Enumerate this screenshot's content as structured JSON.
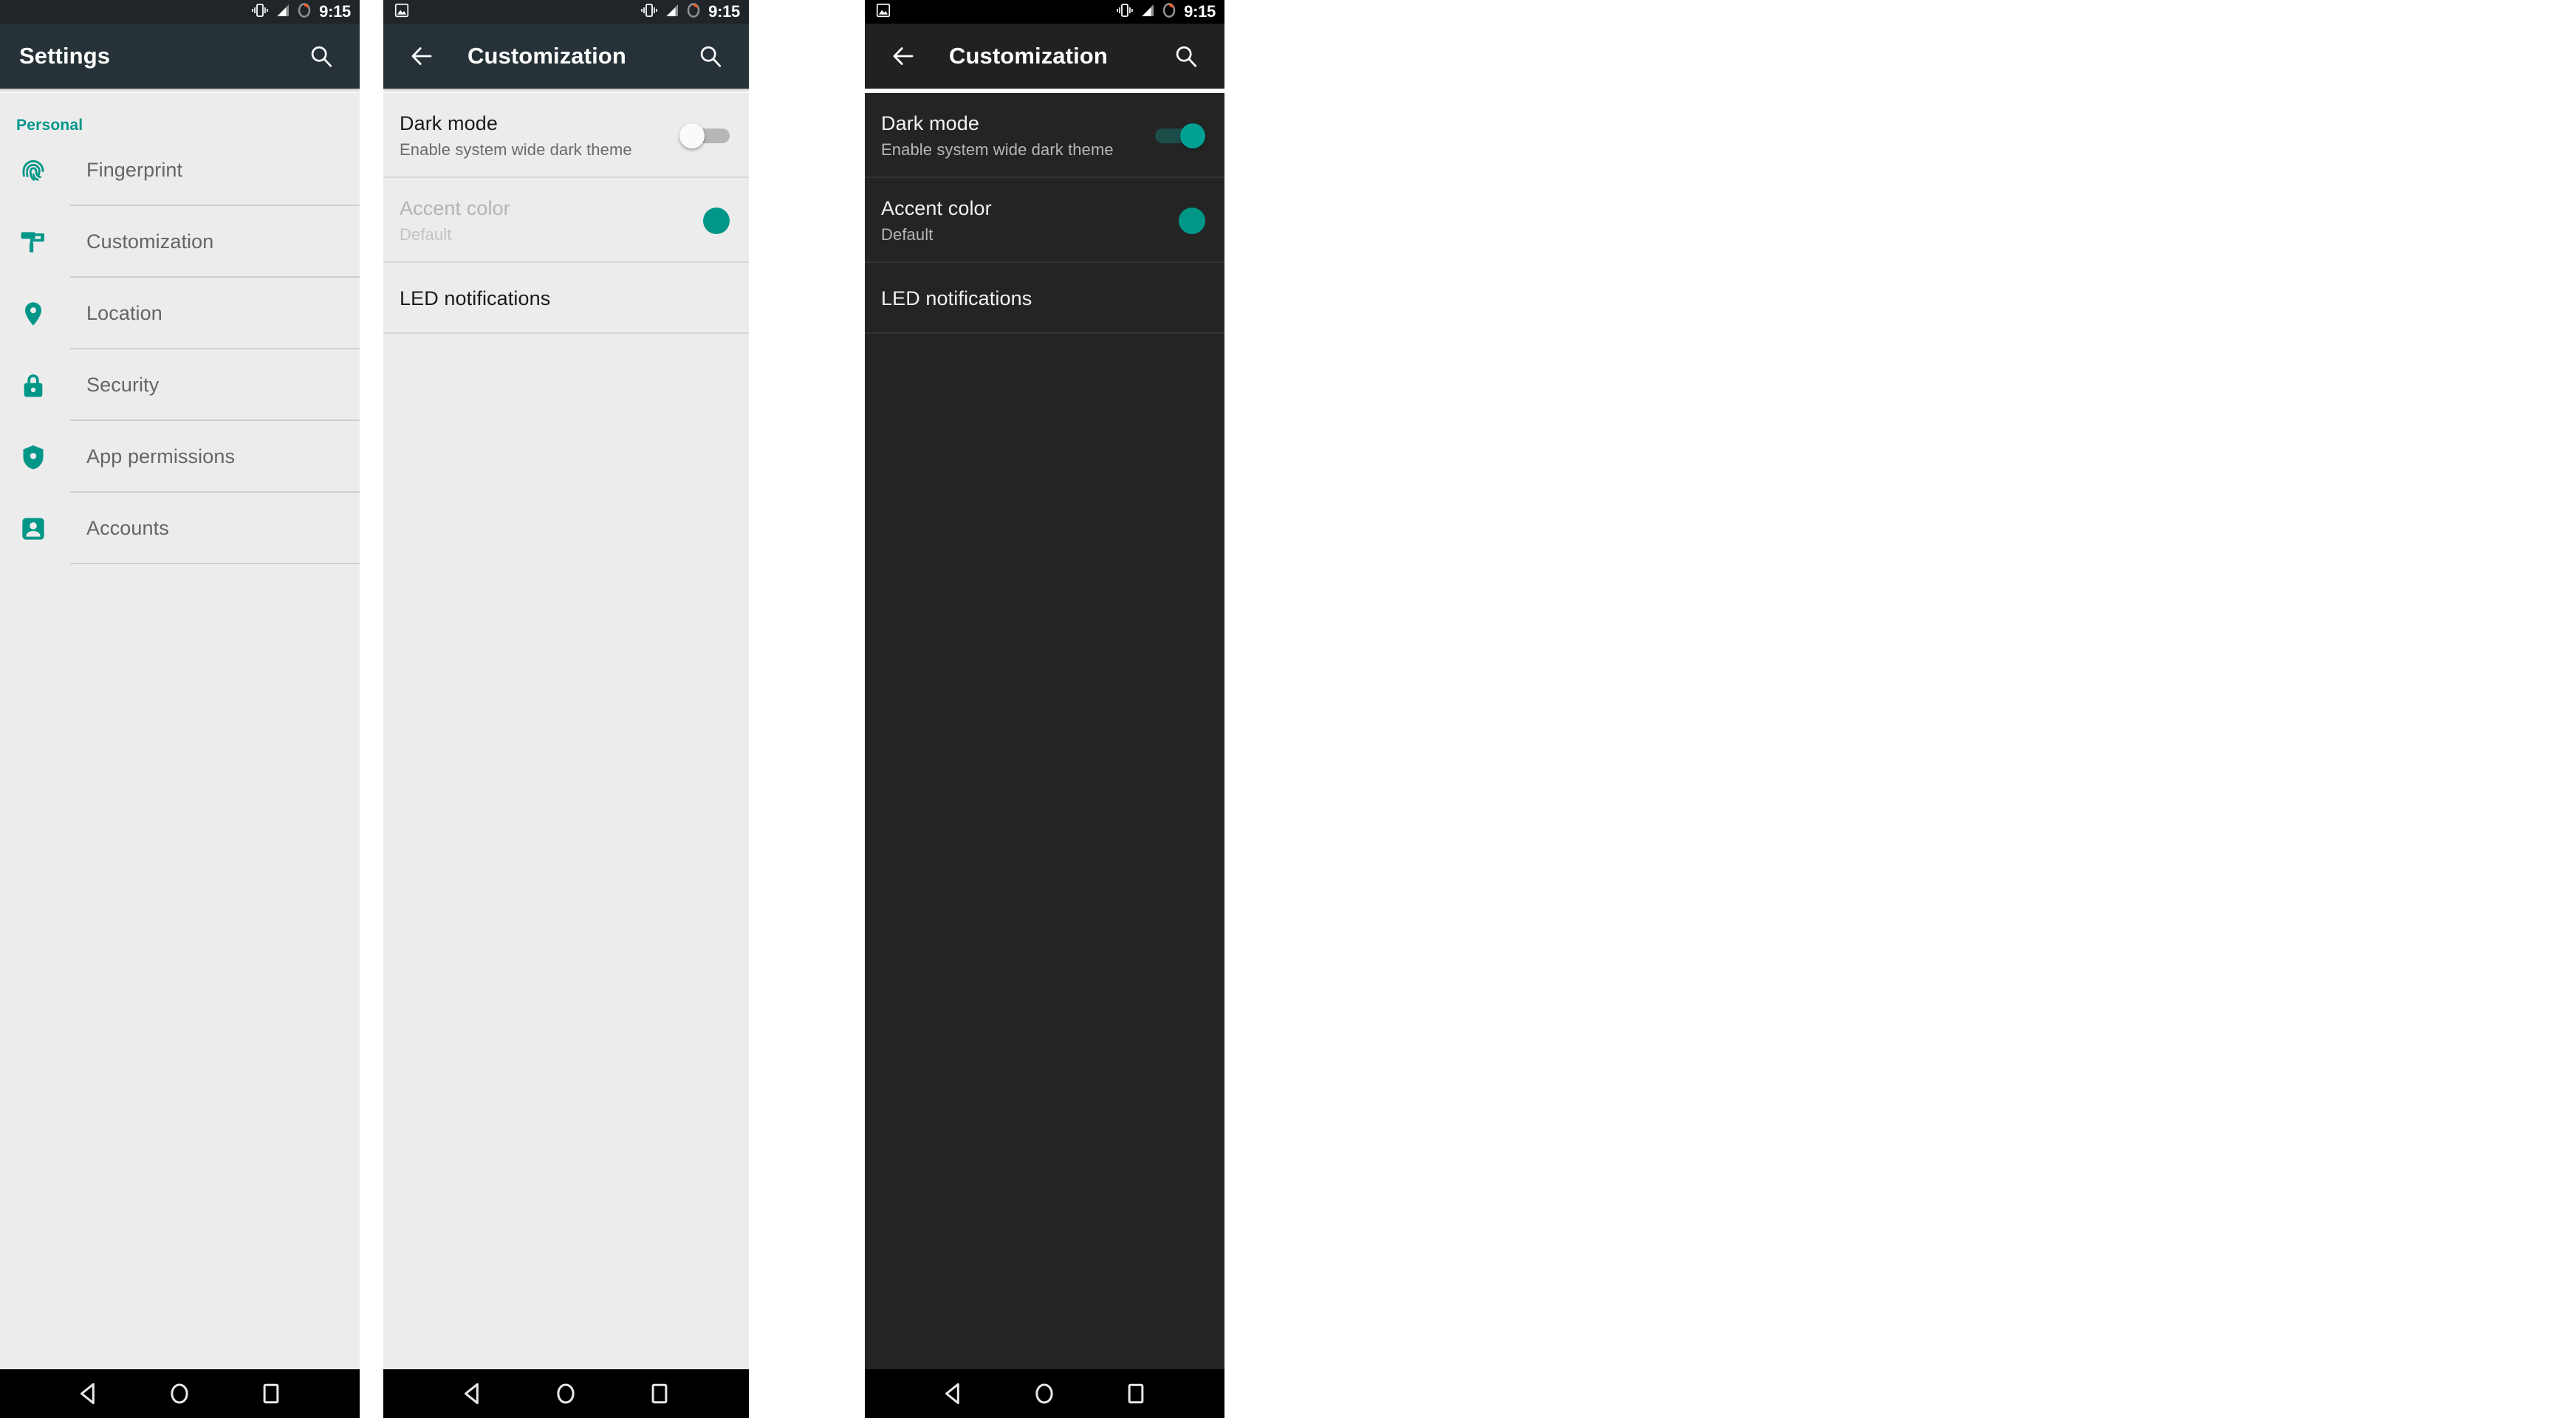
{
  "theme_colors": {
    "accent_teal": "#009688",
    "toolbar_light": "#263238",
    "toolbar_dark": "#212121",
    "statusbar_light": "#1f2528",
    "statusbar_dark": "#000000",
    "content_light": "#ececec",
    "content_dark": "#242424",
    "navbar": "#000000",
    "battery_warning_orange": "#ff5722"
  },
  "status_bar": {
    "time": "9:15",
    "icons_right": [
      "vibrate-icon",
      "signal-icon",
      "battery-icon"
    ],
    "icons_left_screenshot": "screenshot-image-icon"
  },
  "nav_bar": {
    "back_label": "back-triangle-icon",
    "home_label": "home-circle-icon",
    "recents_label": "recents-square-icon"
  },
  "panel1": {
    "toolbar": {
      "title": "Settings",
      "search_icon": "search-icon"
    },
    "section_header": "Personal",
    "items": [
      {
        "label": "Fingerprint",
        "icon": "fingerprint-icon"
      },
      {
        "label": "Customization",
        "icon": "paint-roller-icon"
      },
      {
        "label": "Location",
        "icon": "location-pin-icon"
      },
      {
        "label": "Security",
        "icon": "lock-icon"
      },
      {
        "label": "App permissions",
        "icon": "shield-icon"
      },
      {
        "label": "Accounts",
        "icon": "person-box-icon"
      }
    ]
  },
  "panel2": {
    "toolbar": {
      "back_icon": "arrow-back-icon",
      "title": "Customization",
      "search_icon": "search-icon"
    },
    "rows": [
      {
        "title": "Dark mode",
        "subtitle": "Enable system wide dark theme",
        "control": "switch",
        "switch_state": "off",
        "disabled": false
      },
      {
        "title": "Accent color",
        "subtitle": "Default",
        "control": "color-dot",
        "dot_color": "#009688",
        "disabled": true
      },
      {
        "title": "LED notifications",
        "subtitle": "",
        "control": "none",
        "disabled": false
      }
    ]
  },
  "panel3": {
    "toolbar": {
      "back_icon": "arrow-back-icon",
      "title": "Customization",
      "search_icon": "search-icon"
    },
    "rows": [
      {
        "title": "Dark mode",
        "subtitle": "Enable system wide dark theme",
        "control": "switch",
        "switch_state": "on",
        "disabled": false
      },
      {
        "title": "Accent color",
        "subtitle": "Default",
        "control": "color-dot",
        "dot_color": "#009688",
        "disabled": false
      },
      {
        "title": "LED notifications",
        "subtitle": "",
        "control": "none",
        "disabled": false
      }
    ]
  }
}
